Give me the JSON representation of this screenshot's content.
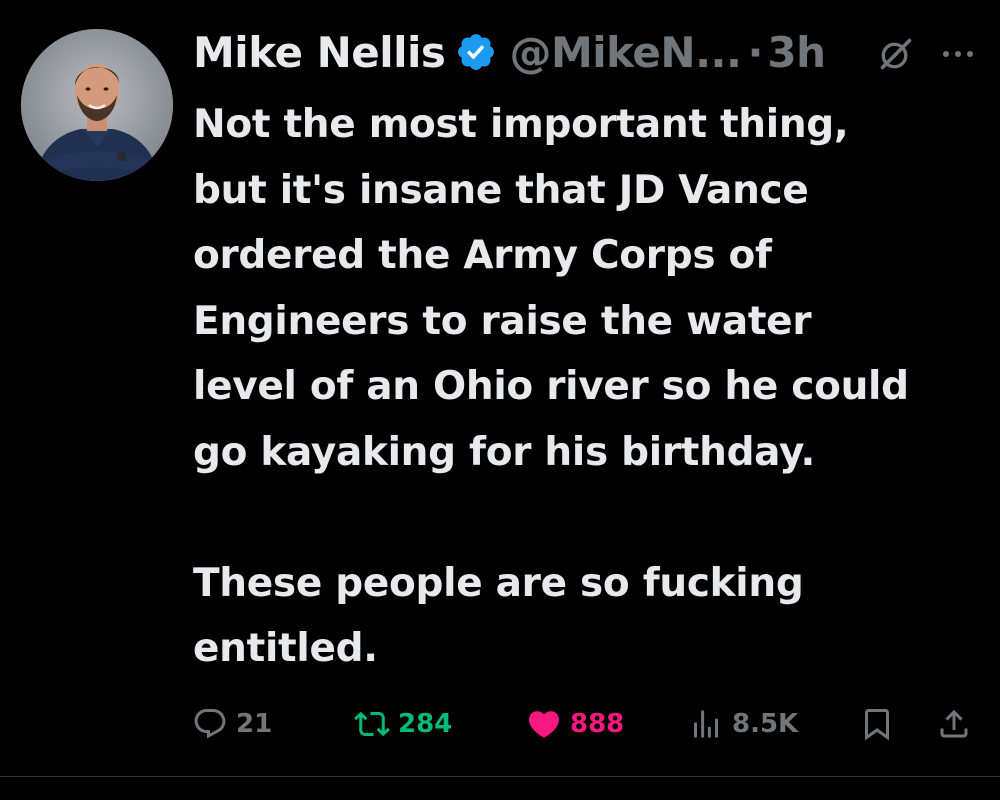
{
  "author": {
    "display_name": "Mike Nellis",
    "handle": "@MikeN...",
    "separator": "·",
    "timestamp": "3h",
    "verified": true
  },
  "tweet": {
    "text": "Not the most important thing,\nbut it's insane that JD Vance\nordered the Army Corps of\nEngineers to raise the water\nlevel of an Ohio river so he could\ngo kayaking for his birthday.\n\nThese people are so fucking\nentitled."
  },
  "metrics": {
    "replies": "21",
    "retweets": "284",
    "likes": "888",
    "views": "8.5K"
  },
  "icons": {
    "verified": "verified-badge-icon",
    "grok": "grok-icon",
    "more": "more-icon",
    "reply": "reply-icon",
    "retweet": "retweet-icon",
    "like": "heart-icon",
    "views": "views-icon",
    "bookmark": "bookmark-icon",
    "share": "share-icon"
  },
  "colors": {
    "background": "#000000",
    "text": "#e7e9ea",
    "secondary": "#71767b",
    "verified": "#1d9bf0",
    "retweet": "#00ba7c",
    "like": "#f91880"
  }
}
